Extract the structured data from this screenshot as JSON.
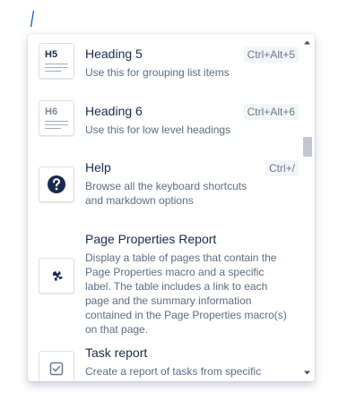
{
  "menu": {
    "items": [
      {
        "title": "Heading 5",
        "description": "Use this for grouping list items",
        "shortcut": "Ctrl+Alt+5",
        "icon": "heading-5-icon",
        "icon_label": "H5"
      },
      {
        "title": "Heading 6",
        "description": "Use this for low level headings",
        "shortcut": "Ctrl+Alt+6",
        "icon": "heading-6-icon",
        "icon_label": "H6"
      },
      {
        "title": "Help",
        "description": "Browse all the keyboard shortcuts and markdown options",
        "shortcut": "Ctrl+/",
        "icon": "question-icon"
      },
      {
        "title": "Page Properties Report",
        "description": "Display a table of pages that contain the Page Properties macro and a specific label. The table includes a link to each page and the summary information contained in the Page Properties macro(s) on that page.",
        "icon": "puzzle-icon"
      },
      {
        "title": "Task report",
        "description": "Create a report of tasks from specific",
        "icon": "checkbox-icon"
      }
    ]
  },
  "scrollbar": {
    "position": 0.35
  },
  "colors": {
    "text": "#172b4d",
    "subtle": "#5e6c84",
    "caret": "#0052cc",
    "help_icon_bg": "#172b4d"
  }
}
